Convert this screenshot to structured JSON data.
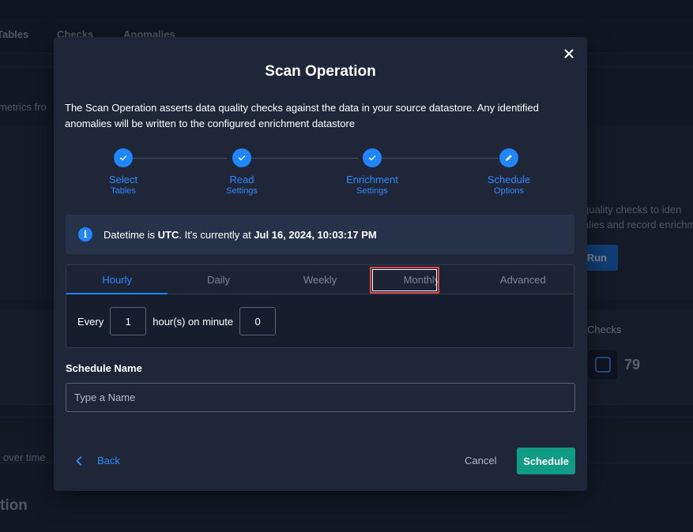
{
  "background": {
    "tabs": [
      "Tables",
      "Checks",
      "Anomalies"
    ],
    "side_text_left": "metrics fro",
    "side_text_right_1": "quality checks to iden",
    "side_text_right_2": "alies and record enrichm",
    "run_label": "Run",
    "checks_label": "Checks",
    "checks_count": "79",
    "over_time_text": "over time",
    "section_heading": "tion"
  },
  "modal": {
    "title": "Scan Operation",
    "close_icon": "close-icon",
    "description": "The Scan Operation asserts data quality checks against the data in your source datastore. Any identified anomalies will be written to the configured enrichment datastore",
    "steps": [
      {
        "title": "Select",
        "subtitle": "Tables",
        "icon": "check-icon",
        "status": "complete"
      },
      {
        "title": "Read",
        "subtitle": "Settings",
        "icon": "check-icon",
        "status": "complete"
      },
      {
        "title": "Enrichment",
        "subtitle": "Settings",
        "icon": "check-icon",
        "status": "complete"
      },
      {
        "title": "Schedule",
        "subtitle": "Options",
        "icon": "pencil-icon",
        "status": "current"
      }
    ],
    "info": {
      "icon": "info-icon",
      "prefix": "Datetime is ",
      "timezone": "UTC",
      "middle": ". It's currently at ",
      "datetime": "Jul 16, 2024, 10:03:17 PM"
    },
    "schedule_tabs": [
      {
        "label": "Hourly",
        "active": true
      },
      {
        "label": "Daily",
        "active": false
      },
      {
        "label": "Weekly",
        "active": false
      },
      {
        "label": "Monthly",
        "active": false,
        "highlighted": true
      },
      {
        "label": "Advanced",
        "active": false
      }
    ],
    "hourly": {
      "every_label": "Every",
      "hours_value": "1",
      "on_minute_label": "hour(s) on minute",
      "minute_value": "0"
    },
    "schedule_name": {
      "label": "Schedule Name",
      "placeholder": "Type a Name",
      "value": ""
    },
    "footer": {
      "back_label": "Back",
      "cancel_label": "Cancel",
      "schedule_label": "Schedule"
    }
  },
  "colors": {
    "accent": "#1f86ff",
    "primary_button": "#0f9b86",
    "highlight_border": "#d9484b"
  }
}
